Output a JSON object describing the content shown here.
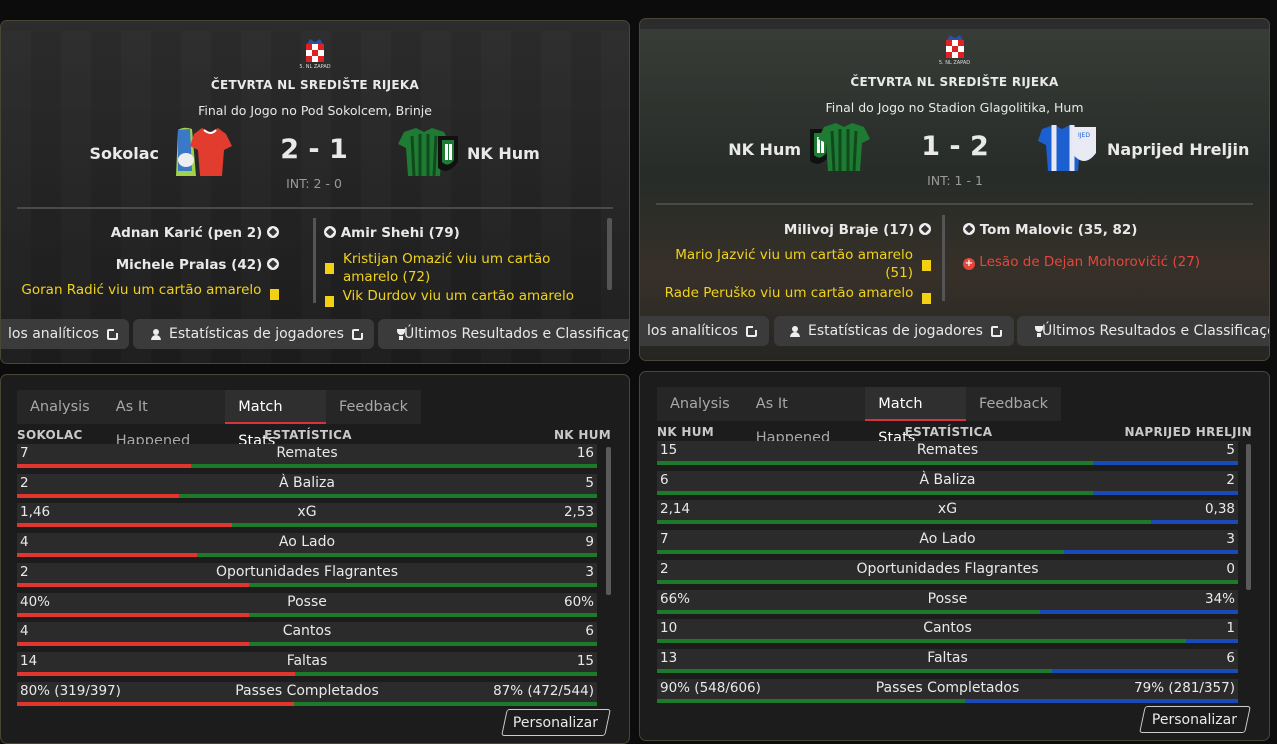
{
  "matches": [
    {
      "competition": "ČETVRTA NL SREDIŠTE RIJEKA",
      "badge_sub": "5. NL ZAPAD",
      "venue": "Final do Jogo no Pod Sokolcem, Brinje",
      "home": "Sokolac",
      "away": "NK Hum",
      "score": "2 - 1",
      "halftime": "INT: 2 - 0",
      "home_events": [
        {
          "text": "Adnan Karić (pen 2)",
          "type": "goal"
        },
        {
          "text": "Michele Pralas (42)",
          "type": "goal"
        },
        {
          "text": "Goran Radić viu um cartão amarelo",
          "type": "yellow"
        }
      ],
      "away_events": [
        {
          "text": "Amir Shehi (79)",
          "type": "goal"
        },
        {
          "text": "Kristijan Omazić viu um cartão amarelo (72)",
          "line1": "Kristijan Omazić viu um cartão",
          "line2": "amarelo (72)",
          "type": "yellow"
        },
        {
          "text": "Vik Durdov viu um cartão amarelo",
          "type": "yellow"
        }
      ],
      "buttons": [
        "los analíticos",
        "Estatísticas de jogadores",
        "Últimos Resultados e Classificações"
      ]
    },
    {
      "competition": "ČETVRTA NL SREDIŠTE RIJEKA",
      "badge_sub": "5. NL ZAPAD",
      "venue": "Final do Jogo no Stadion Glagolitika, Hum",
      "home": "NK Hum",
      "away": "Naprijed Hreljin",
      "score": "1 - 2",
      "halftime": "INT: 1 - 1",
      "home_events": [
        {
          "text": "Milivoj Braje (17)",
          "type": "goal"
        },
        {
          "text": "Mario Jazvić viu um cartão amarelo (51)",
          "line1": "Mario Jazvić viu um cartão amarelo",
          "line2": "(51)",
          "type": "yellow"
        },
        {
          "text": "Rade Peruško viu um cartão amarelo",
          "type": "yellow"
        }
      ],
      "away_events": [
        {
          "text": "Tom Malovic (35, 82)",
          "type": "goal"
        },
        {
          "text": "Lesão de Dejan Mohorovičić (27)",
          "type": "injury"
        }
      ],
      "buttons": [
        "los analíticos",
        "Estatísticas de jogadores",
        "Últimos Resultados e Classificações"
      ]
    }
  ],
  "tabs": [
    "Analysis",
    "As It Happened",
    "Match Stats",
    "Feedback"
  ],
  "active_tab": "Match Stats",
  "stat_col_label": "ESTATÍSTICA",
  "customize_label": "Personalizar",
  "stat_panels": [
    {
      "home": "SOKOLAC",
      "away": "NK HUM",
      "home_color": "#e0362e",
      "away_color": "#1d7a2a",
      "rows": [
        {
          "label": "Remates",
          "home": "7",
          "away": "16",
          "home_share": 0.3
        },
        {
          "label": "À Baliza",
          "home": "2",
          "away": "5",
          "home_share": 0.28
        },
        {
          "label": "xG",
          "home": "1,46",
          "away": "2,53",
          "home_share": 0.37
        },
        {
          "label": "Ao Lado",
          "home": "4",
          "away": "9",
          "home_share": 0.31
        },
        {
          "label": "Oportunidades Flagrantes",
          "home": "2",
          "away": "3",
          "home_share": 0.4
        },
        {
          "label": "Posse",
          "home": "40%",
          "away": "60%",
          "home_share": 0.4
        },
        {
          "label": "Cantos",
          "home": "4",
          "away": "6",
          "home_share": 0.4
        },
        {
          "label": "Faltas",
          "home": "14",
          "away": "15",
          "home_share": 0.48
        },
        {
          "label": "Passes Completados",
          "home": "80% (319/397)",
          "away": "87% (472/544)",
          "home_share": 0.478
        }
      ]
    },
    {
      "home": "NK HUM",
      "away": "NAPRIJED HRELJIN",
      "home_color": "#1d7a2a",
      "away_color": "#1a49b8",
      "rows": [
        {
          "label": "Remates",
          "home": "15",
          "away": "5",
          "home_share": 0.75
        },
        {
          "label": "À Baliza",
          "home": "6",
          "away": "2",
          "home_share": 0.75
        },
        {
          "label": "xG",
          "home": "2,14",
          "away": "0,38",
          "home_share": 0.85
        },
        {
          "label": "Ao Lado",
          "home": "7",
          "away": "3",
          "home_share": 0.7
        },
        {
          "label": "Oportunidades Flagrantes",
          "home": "2",
          "away": "0",
          "home_share": 1.0
        },
        {
          "label": "Posse",
          "home": "66%",
          "away": "34%",
          "home_share": 0.66
        },
        {
          "label": "Cantos",
          "home": "10",
          "away": "1",
          "home_share": 0.91
        },
        {
          "label": "Faltas",
          "home": "13",
          "away": "6",
          "home_share": 0.68
        },
        {
          "label": "Passes Completados",
          "home": "90% (548/606)",
          "away": "79% (281/357)",
          "home_share": 0.53
        }
      ]
    }
  ]
}
